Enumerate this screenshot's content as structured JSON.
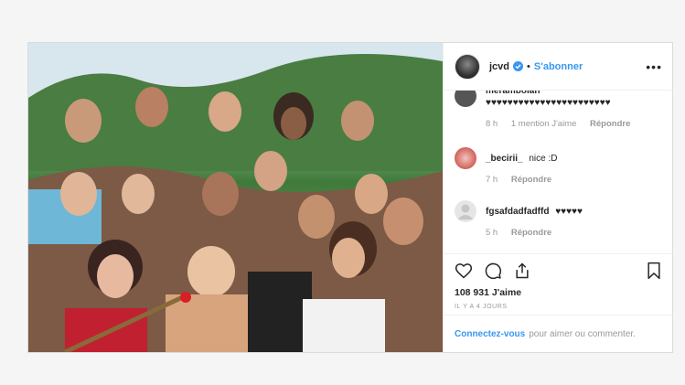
{
  "header": {
    "username": "jcvd",
    "dot": "•",
    "follow_label": "S'abonner",
    "more_label": "•••"
  },
  "comments": [
    {
      "username": "meramboian",
      "text": "♥♥♥♥♥♥♥♥♥♥♥♥♥♥♥♥♥♥♥♥♥♥♥",
      "time": "8 h",
      "likes": "1 mention J'aime",
      "reply": "Répondre"
    },
    {
      "username": "_becirii_",
      "text": "nice :D",
      "time": "7 h",
      "reply": "Répondre"
    },
    {
      "username": "fgsafdadfadffd",
      "text": "♥♥♥♥♥",
      "time": "5 h",
      "reply": "Répondre"
    }
  ],
  "post": {
    "likes": "108 931 J'aime",
    "ago": "IL Y A 4 JOURS"
  },
  "login": {
    "link": "Connectez-vous",
    "text": "pour aimer ou commenter."
  },
  "icons": {
    "heart": "heart-icon",
    "comment": "comment-icon",
    "share": "share-icon",
    "save": "bookmark-icon",
    "verified": "verified-badge-icon"
  },
  "colors": {
    "link": "#3897f0",
    "text": "#262626",
    "muted": "#999999"
  }
}
